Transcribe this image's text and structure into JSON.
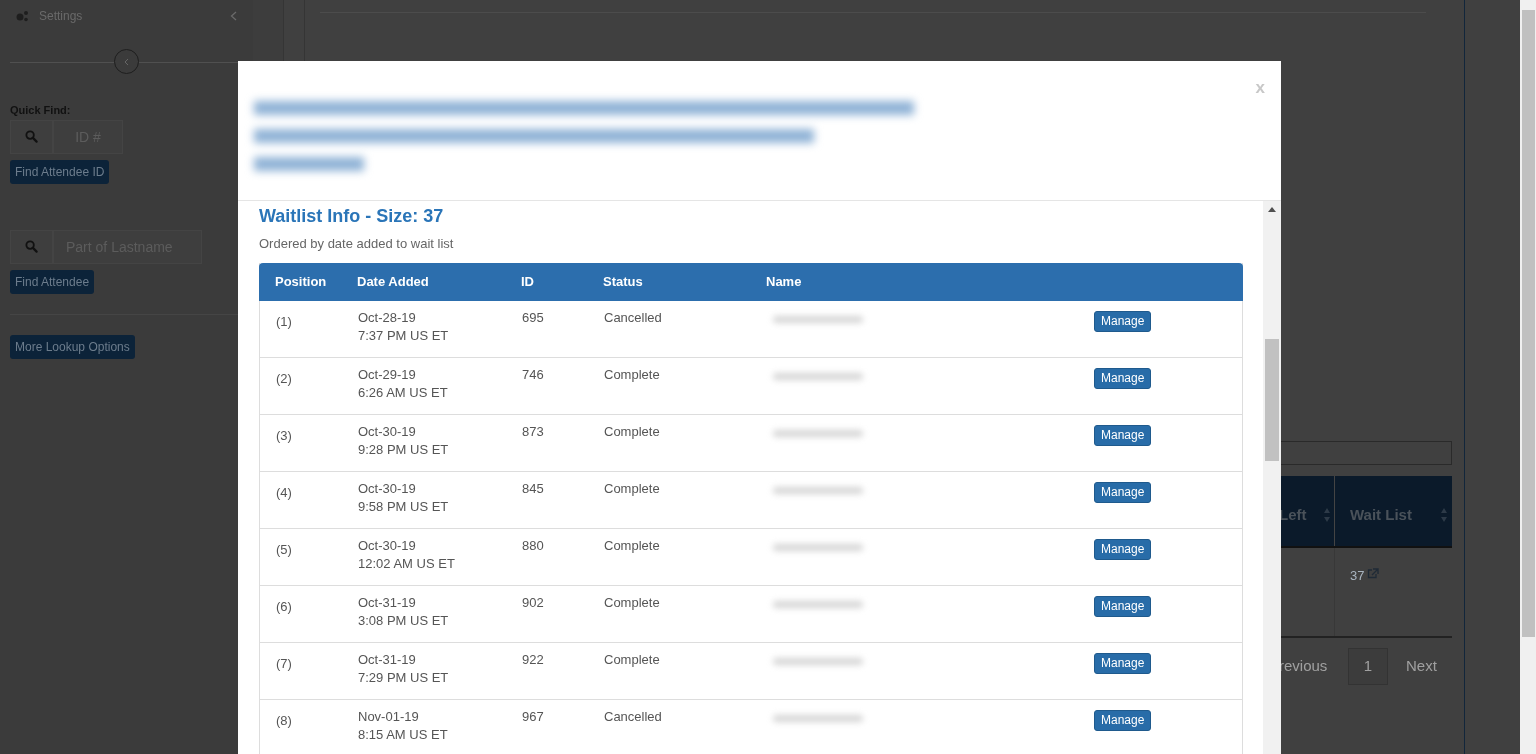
{
  "sidebar": {
    "settings_label": "Settings",
    "quick_find_label": "Quick Find:",
    "id_search": {
      "placeholder": "ID #"
    },
    "find_id_button": "Find Attendee ID",
    "lastname_search": {
      "placeholder": "Part of Lastname"
    },
    "find_attendee_button": "Find Attendee",
    "more_options_button": "More Lookup Options"
  },
  "background_table": {
    "columns": [
      "Left",
      "Wait List"
    ],
    "rows": [
      {
        "column_1": "",
        "wait_list": "37"
      }
    ]
  },
  "pagination": {
    "previous": "revious",
    "pages": [
      {
        "label": "1",
        "selected": true
      }
    ],
    "next": "Next"
  },
  "modal": {
    "close": "x",
    "heading": "Waitlist Info - Size: 37",
    "subtitle": "Ordered by date added to wait list",
    "columns": [
      "Position",
      "Date Added",
      "ID",
      "Status",
      "Name"
    ],
    "rows": [
      {
        "position": "(1)",
        "date": "Oct-28-19",
        "time": "7:37 PM US ET",
        "id": "695",
        "status": "Cancelled",
        "action": "Manage"
      },
      {
        "position": "(2)",
        "date": "Oct-29-19",
        "time": "6:26 AM US ET",
        "id": "746",
        "status": "Complete",
        "action": "Manage"
      },
      {
        "position": "(3)",
        "date": "Oct-30-19",
        "time": "9:28 PM US ET",
        "id": "873",
        "status": "Complete",
        "action": "Manage"
      },
      {
        "position": "(4)",
        "date": "Oct-30-19",
        "time": "9:58 PM US ET",
        "id": "845",
        "status": "Complete",
        "action": "Manage"
      },
      {
        "position": "(5)",
        "date": "Oct-30-19",
        "time": "12:02 AM US ET",
        "id": "880",
        "status": "Complete",
        "action": "Manage"
      },
      {
        "position": "(6)",
        "date": "Oct-31-19",
        "time": "3:08 PM US ET",
        "id": "902",
        "status": "Complete",
        "action": "Manage"
      },
      {
        "position": "(7)",
        "date": "Oct-31-19",
        "time": "7:29 PM US ET",
        "id": "922",
        "status": "Complete",
        "action": "Manage"
      },
      {
        "position": "(8)",
        "date": "Nov-01-19",
        "time": "8:15 AM US ET",
        "id": "967",
        "status": "Cancelled",
        "action": "Manage"
      }
    ]
  }
}
